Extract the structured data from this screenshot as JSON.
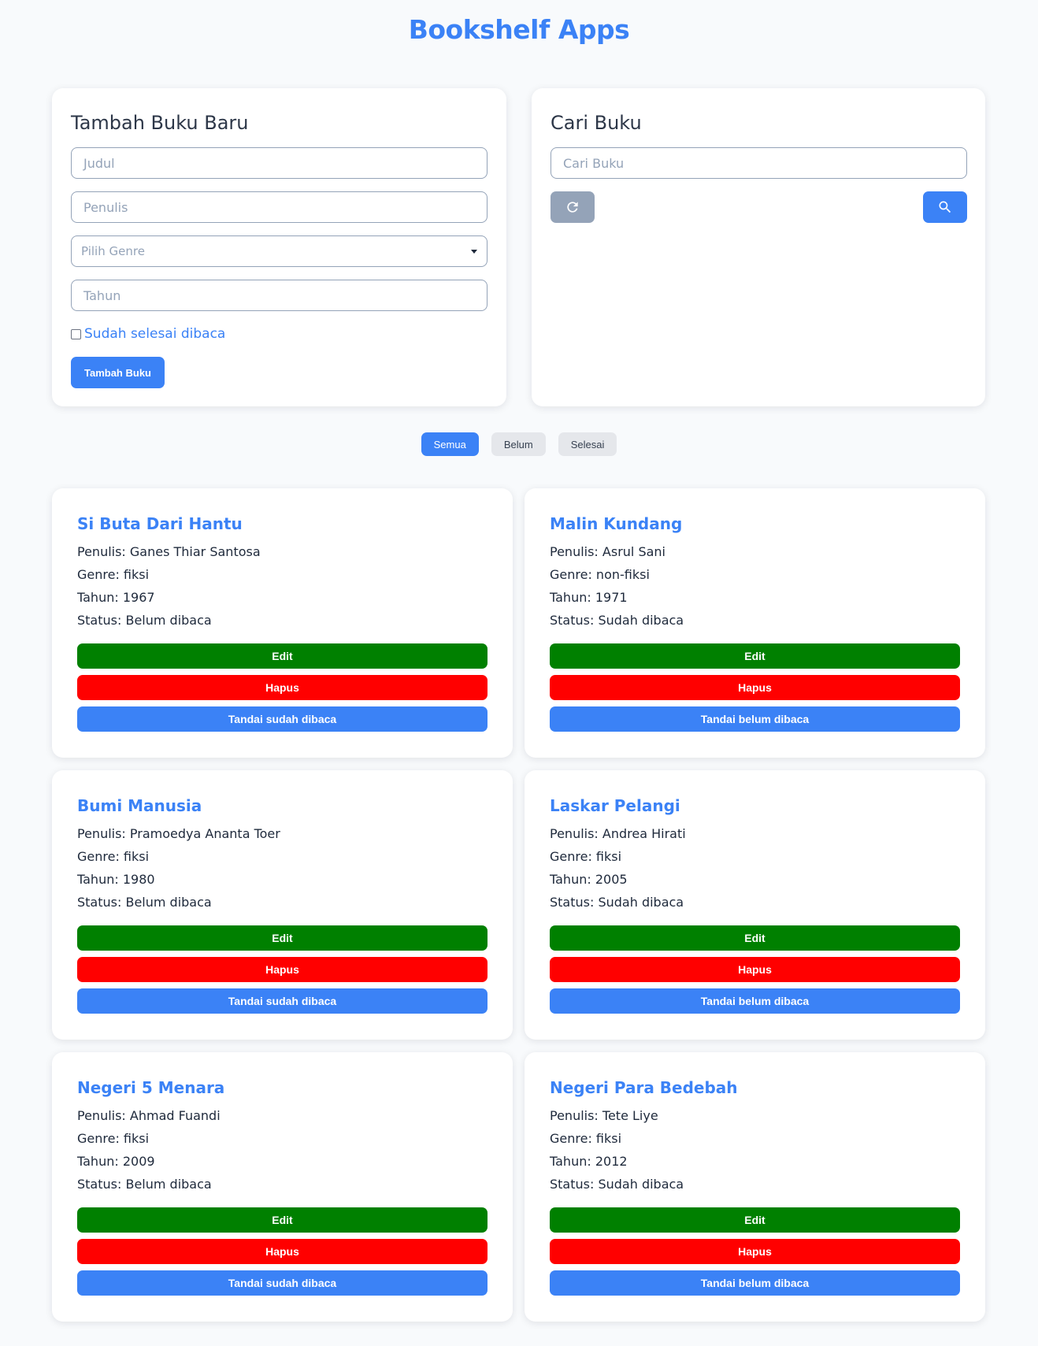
{
  "app": {
    "title": "Bookshelf Apps"
  },
  "add_form": {
    "heading": "Tambah Buku Baru",
    "title_placeholder": "Judul",
    "author_placeholder": "Penulis",
    "genre_placeholder": "Pilih Genre",
    "year_placeholder": "Tahun",
    "finished_label": "Sudah selesai dibaca",
    "finished_checked": false,
    "submit_label": "Tambah Buku"
  },
  "search": {
    "heading": "Cari Buku",
    "placeholder": "Cari Buku",
    "reset_icon": "refresh-icon",
    "search_icon": "search-icon"
  },
  "filters": [
    {
      "label": "Semua",
      "active": true
    },
    {
      "label": "Belum",
      "active": false
    },
    {
      "label": "Selesai",
      "active": false
    }
  ],
  "colors": {
    "primary": "#3b82f6",
    "edit": "#008000",
    "delete": "#ff0000",
    "muted": "#94a3b8",
    "background": "#f8fafc"
  },
  "labels": {
    "author_prefix": "Penulis: ",
    "genre_prefix": "Genre: ",
    "year_prefix": "Tahun: ",
    "status_prefix": "Status: ",
    "edit": "Edit",
    "delete": "Hapus"
  },
  "books": [
    {
      "title": "Si Buta Dari Hantu",
      "author": "Penulis: Ganes Thiar Santosa",
      "genre": "Genre: fiksi",
      "year": "Tahun: 1967",
      "status": "Status: Belum dibaca",
      "toggle_label": "Tandai sudah dibaca"
    },
    {
      "title": "Malin Kundang",
      "author": "Penulis: Asrul Sani",
      "genre": "Genre: non-fiksi",
      "year": "Tahun: 1971",
      "status": "Status: Sudah dibaca",
      "toggle_label": "Tandai belum dibaca"
    },
    {
      "title": "Bumi Manusia",
      "author": "Penulis: Pramoedya Ananta Toer",
      "genre": "Genre: fiksi",
      "year": "Tahun: 1980",
      "status": "Status: Belum dibaca",
      "toggle_label": "Tandai sudah dibaca"
    },
    {
      "title": "Laskar Pelangi",
      "author": "Penulis: Andrea Hirati",
      "genre": "Genre: fiksi",
      "year": "Tahun: 2005",
      "status": "Status: Sudah dibaca",
      "toggle_label": "Tandai belum dibaca"
    },
    {
      "title": "Negeri 5 Menara",
      "author": "Penulis: Ahmad Fuandi",
      "genre": "Genre: fiksi",
      "year": "Tahun: 2009",
      "status": "Status: Belum dibaca",
      "toggle_label": "Tandai sudah dibaca"
    },
    {
      "title": "Negeri Para Bedebah",
      "author": "Penulis: Tete Liye",
      "genre": "Genre: fiksi",
      "year": "Tahun: 2012",
      "status": "Status: Sudah dibaca",
      "toggle_label": "Tandai belum dibaca"
    }
  ]
}
